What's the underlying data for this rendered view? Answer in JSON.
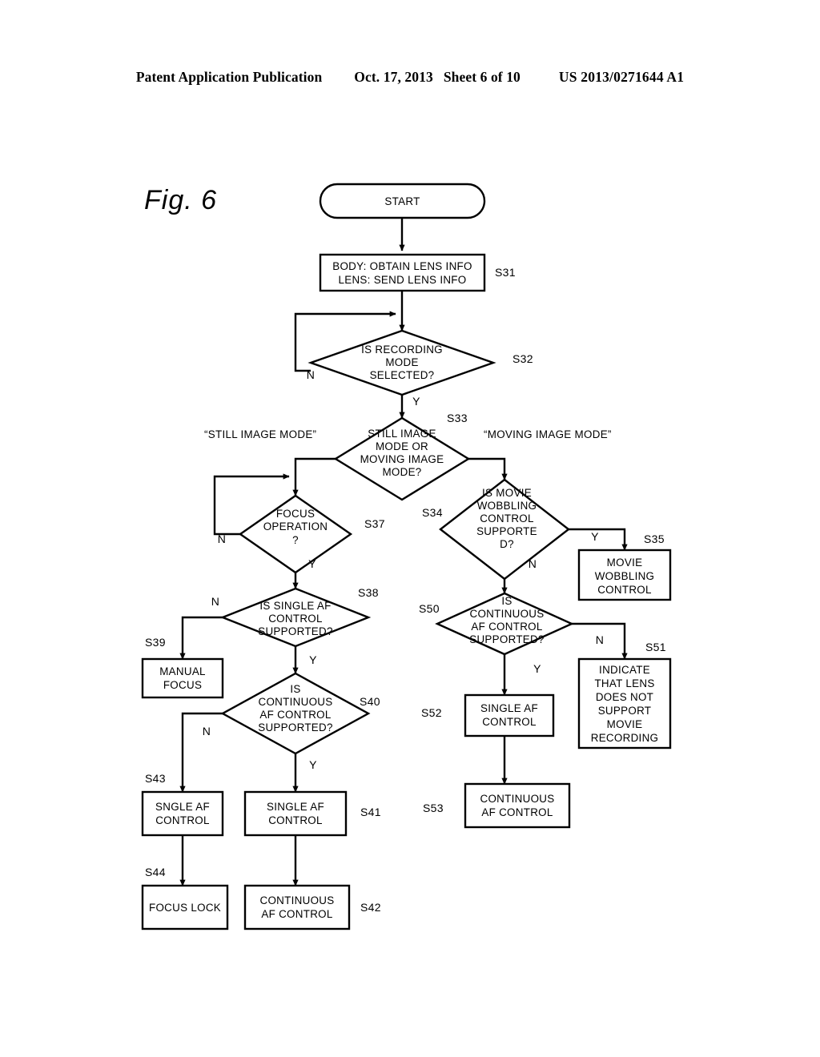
{
  "header": {
    "publication": "Patent Application Publication",
    "date": "Oct. 17, 2013",
    "sheet": "Sheet 6 of 10",
    "pub_number": "US 2013/0271644 A1"
  },
  "figure": {
    "label": "Fig. 6"
  },
  "nodes": {
    "start": {
      "id": "",
      "lines": [
        "START"
      ],
      "shape": "terminator"
    },
    "s31": {
      "id": "S31",
      "lines": [
        "BODY: OBTAIN LENS INFO",
        "LENS: SEND LENS INFO"
      ],
      "shape": "process"
    },
    "s32": {
      "id": "S32",
      "lines": [
        "IS RECORDING",
        "MODE",
        "SELECTED?"
      ],
      "shape": "decision"
    },
    "s33": {
      "id": "S33",
      "lines": [
        "STILL IMAGE",
        "MODE OR",
        "MOVING IMAGE",
        "MODE?"
      ],
      "shape": "decision"
    },
    "s37": {
      "id": "S37",
      "lines": [
        "FOCUS",
        "OPERATION",
        "?"
      ],
      "shape": "decision"
    },
    "s34": {
      "id": "S34",
      "lines": [
        "IS MOVIE",
        "WOBBLING",
        "CONTROL",
        "SUPPORTE",
        "D?"
      ],
      "shape": "decision"
    },
    "s35": {
      "id": "S35",
      "lines": [
        "MOVIE",
        "WOBBLING",
        "CONTROL"
      ],
      "shape": "process"
    },
    "s38": {
      "id": "S38",
      "lines": [
        "IS SINGLE AF",
        "CONTROL",
        "SUPPORTED?"
      ],
      "shape": "decision"
    },
    "s39": {
      "id": "S39",
      "lines": [
        "MANUAL",
        "FOCUS"
      ],
      "shape": "process"
    },
    "s50": {
      "id": "S50",
      "lines": [
        "IS",
        "CONTINUOUS",
        "AF CONTROL",
        "SUPPORTED?"
      ],
      "shape": "decision"
    },
    "s51": {
      "id": "S51",
      "lines": [
        "INDICATE",
        "THAT LENS",
        "DOES NOT",
        "SUPPORT",
        "MOVIE",
        "RECORDING"
      ],
      "shape": "process"
    },
    "s40": {
      "id": "S40",
      "lines": [
        "IS",
        "CONTINUOUS",
        "AF CONTROL",
        "SUPPORTED?"
      ],
      "shape": "decision"
    },
    "s52": {
      "id": "S52",
      "lines": [
        "SINGLE AF",
        "CONTROL"
      ],
      "shape": "process"
    },
    "s43": {
      "id": "S43",
      "lines": [
        "SNGLE AF",
        "CONTROL"
      ],
      "shape": "process"
    },
    "s41": {
      "id": "S41",
      "lines": [
        "SINGLE AF",
        "CONTROL"
      ],
      "shape": "process"
    },
    "s53": {
      "id": "S53",
      "lines": [
        "CONTINUOUS",
        "AF CONTROL"
      ],
      "shape": "process"
    },
    "s44": {
      "id": "S44",
      "lines": [
        "FOCUS LOCK"
      ],
      "shape": "process"
    },
    "s42": {
      "id": "S42",
      "lines": [
        "CONTINUOUS",
        "AF CONTROL"
      ],
      "shape": "process"
    }
  },
  "branch_labels": {
    "s32_n": "N",
    "s32_y": "Y",
    "s37_n": "N",
    "s37_y": "Y",
    "s34_y": "Y",
    "s34_n": "N",
    "s38_n": "N",
    "s38_y": "Y",
    "s50_n": "N",
    "s50_y": "Y",
    "s40_n": "N",
    "s40_y": "Y"
  },
  "mode_labels": {
    "still": "“STILL IMAGE MODE”",
    "moving": "“MOVING IMAGE MODE”"
  },
  "colors": {
    "ink": "#000000",
    "paper": "#ffffff"
  }
}
